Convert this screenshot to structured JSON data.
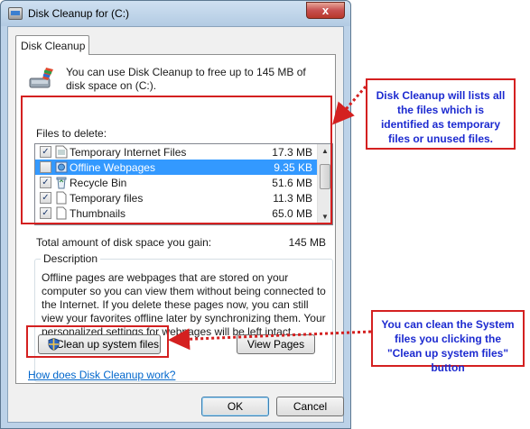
{
  "window": {
    "title": "Disk Cleanup for  (C:)",
    "close_label": "x"
  },
  "tab": {
    "label": "Disk Cleanup"
  },
  "header": {
    "text": "You can use Disk Cleanup to free up to 145 MB of disk space on  (C:)."
  },
  "files": {
    "label": "Files to delete:",
    "items": [
      {
        "name": "Temporary Internet Files",
        "size": "17.3 MB",
        "checked": true,
        "icon": "temporary-internet-files-icon"
      },
      {
        "name": "Offline Webpages",
        "size": "9.35 KB",
        "checked": false,
        "icon": "offline-webpages-icon",
        "selected": true
      },
      {
        "name": "Recycle Bin",
        "size": "51.6 MB",
        "checked": true,
        "icon": "recycle-bin-icon"
      },
      {
        "name": "Temporary files",
        "size": "11.3 MB",
        "checked": true,
        "icon": "temporary-files-icon"
      },
      {
        "name": "Thumbnails",
        "size": "65.0 MB",
        "checked": true,
        "icon": "thumbnails-icon"
      }
    ]
  },
  "total": {
    "label": "Total amount of disk space you gain:",
    "value": "145 MB"
  },
  "description": {
    "legend": "Description",
    "text": "Offline pages are webpages that are stored on your computer so you can view them without being connected to the Internet.  If you delete these pages now, you can still view your favorites offline later by synchronizing them.  Your personalized settings for webpages will be left intact."
  },
  "buttons": {
    "cleanup_system": "Clean up system files",
    "view_pages": "View Pages",
    "ok": "OK",
    "cancel": "Cancel"
  },
  "link": {
    "how_does": "How does Disk Cleanup work?"
  },
  "callouts": {
    "files": "Disk Cleanup will lists all the files which is identified as temporary files or unused files.",
    "system": "You can clean the System files you clicking the \"Clean up system files\" button"
  },
  "colors": {
    "annotation_red": "#d42020",
    "callout_text": "#1c2ad0",
    "selection": "#3399ff",
    "link": "#0066cc"
  }
}
